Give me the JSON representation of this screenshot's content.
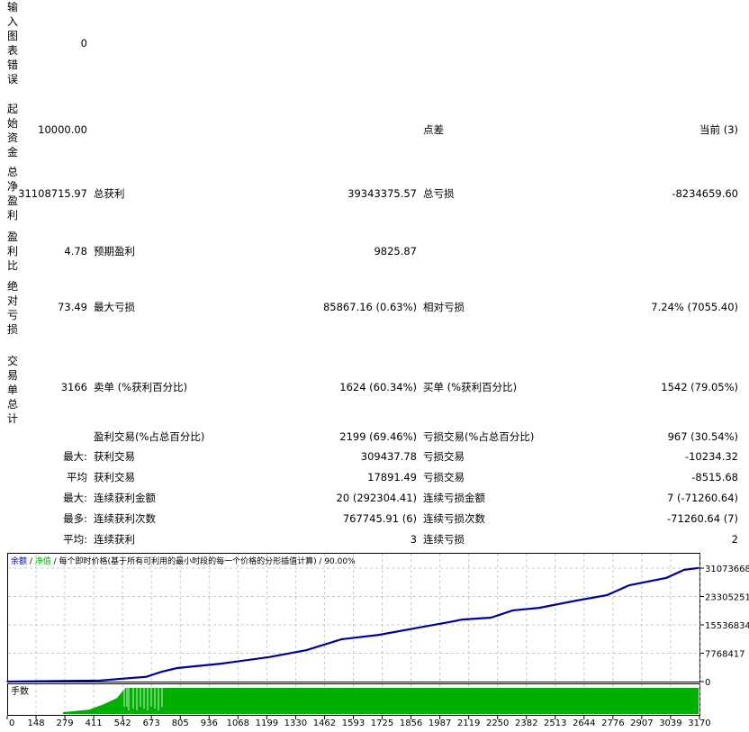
{
  "report": {
    "rows": [
      {
        "vlabel": "输入图表错误",
        "v1": "0"
      },
      {
        "vlabel": "起始资金",
        "v1": "10000.00",
        "l3": "点差",
        "v5": "当前 (3)"
      },
      {
        "vlabel": "总净盈利",
        "v1": "31108715.97",
        "l2": "总获利",
        "v3": "39343375.57",
        "l4": "总亏损",
        "v5": "-8234659.60"
      },
      {
        "vlabel": "盈利比",
        "v1": "4.78",
        "l2": "预期盈利",
        "v3": "9825.87"
      },
      {
        "vlabel": "绝对亏损",
        "v1": "73.49",
        "l2": "最大亏损",
        "v3": "85867.16 (0.63%)",
        "l4": "相对亏损",
        "v5": "7.24% (7055.40)"
      },
      {
        "vlabel": "交易单总计",
        "v1": "3166",
        "l2": "卖单 (%获利百分比)",
        "v3": "1624 (60.34%)",
        "l4": "买单 (%获利百分比)",
        "v5": "1542 (79.05%)"
      }
    ],
    "stats": [
      {
        "prefix": "",
        "l2": "盈利交易(%占总百分比)",
        "v3": "2199 (69.46%)",
        "l4": "亏损交易(%占总百分比)",
        "v5": "967 (30.54%)"
      },
      {
        "prefix": "最大:",
        "l2": "获利交易",
        "v3": "309437.78",
        "l4": "亏损交易",
        "v5": "-10234.32"
      },
      {
        "prefix": "平均",
        "l2": "获利交易",
        "v3": "17891.49",
        "l4": "亏损交易",
        "v5": "-8515.68"
      },
      {
        "prefix": "最大:",
        "l2": "连续获利金额",
        "v3": "20 (292304.41)",
        "l4": "连续亏损金额",
        "v5": "7 (-71260.64)"
      },
      {
        "prefix": "最多:",
        "l2": "连续获利次数",
        "v3": "767745.91 (6)",
        "l4": "连续亏损次数",
        "v5": "-71260.64 (7)"
      },
      {
        "prefix": "平均:",
        "l2": "连续获利",
        "v3": "3",
        "l4": "连续亏损",
        "v5": "2"
      }
    ]
  },
  "chart_data": {
    "type": "line",
    "legend": {
      "balance": "余额",
      "sep1": " / ",
      "equity": "净值",
      "desc": " / 每个即时价格(基于所有可利用的最小时段的每一个价格的分形插值计算) / 90.00%"
    },
    "lots_label": "手数",
    "colors": {
      "balance": "#0000a0",
      "equity": "#00b000",
      "lots": "#00b000",
      "grid": "#c8c8c8"
    },
    "x_ticks": [
      0,
      148,
      279,
      411,
      542,
      673,
      805,
      936,
      1068,
      1199,
      1330,
      1462,
      1593,
      1725,
      1856,
      1987,
      2119,
      2250,
      2382,
      2513,
      2644,
      2776,
      2907,
      3039,
      3170
    ],
    "y_ticks": [
      0,
      7768417,
      15536834,
      23305251,
      31073668
    ],
    "ylim": [
      0,
      31073668
    ],
    "grid": true,
    "balance": [
      [
        0,
        10000
      ],
      [
        440,
        300000
      ],
      [
        650,
        1300000
      ],
      [
        720,
        2700000
      ],
      [
        790,
        3700000
      ],
      [
        990,
        4900000
      ],
      [
        1210,
        6700000
      ],
      [
        1380,
        8600000
      ],
      [
        1540,
        11600000
      ],
      [
        1710,
        12800000
      ],
      [
        1910,
        15000000
      ],
      [
        2030,
        16300000
      ],
      [
        2090,
        17000000
      ],
      [
        2220,
        17500000
      ],
      [
        2320,
        19500000
      ],
      [
        2440,
        20200000
      ],
      [
        2610,
        22200000
      ],
      [
        2750,
        23700000
      ],
      [
        2850,
        26400000
      ],
      [
        3020,
        28400000
      ],
      [
        3100,
        30600000
      ],
      [
        3166,
        31118716
      ]
    ],
    "lots_profile": [
      [
        270,
        0.07
      ],
      [
        390,
        0.17
      ],
      [
        455,
        0.37
      ],
      [
        515,
        0.6
      ],
      [
        555,
        1.0
      ],
      [
        3166,
        1.0
      ]
    ]
  }
}
